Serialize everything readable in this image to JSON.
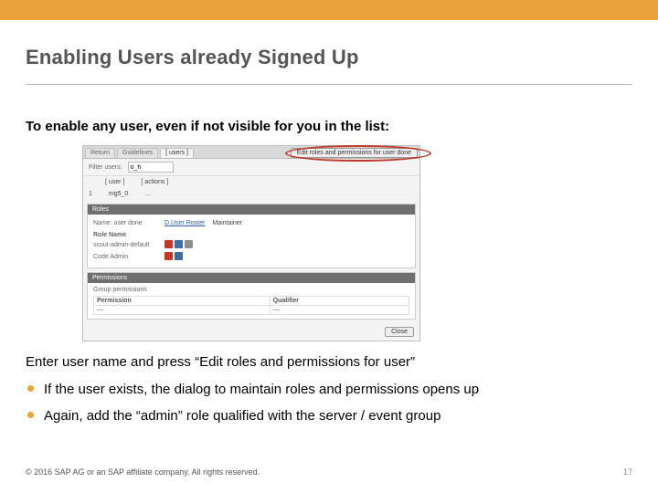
{
  "accent": "#e8a33d",
  "title": "Enabling Users already Signed Up",
  "lead": "To enable any user, even if not visible for you in the list:",
  "after_shot": "Enter user name and press “Edit roles and permissions for user”",
  "bullets": [
    "If the user exists, the dialog to maintain roles and permissions opens up",
    "Again, add the “admin” role qualified with the server / event group"
  ],
  "footer": {
    "copyright": "© 2016 SAP AG or an SAP affiliate company. All rights reserved.",
    "page": "17"
  },
  "screenshot": {
    "tabs": [
      "Return",
      "Guidelines",
      "[ users ]"
    ],
    "editbar_button": "Edit roles and permissions for user done",
    "filter_label": "Filter users:",
    "filter_value": "o_h",
    "list": {
      "columns": [
        "",
        "[ user ]",
        "[ actions ]"
      ],
      "row": {
        "idx": "1",
        "user": "mg5_0",
        "actions": "…"
      }
    },
    "panel1": {
      "title": "Roles",
      "name_label": "Name: user done",
      "name_link": "D.User Roster",
      "maintain": "Maintainer",
      "rolename_label": "Role Name",
      "rows": [
        "scout-admin-default",
        "Code Admin"
      ]
    },
    "panel2": {
      "title": "Permissions",
      "perm_head": "Group permissions",
      "columns": [
        "Permission",
        "Qualifier"
      ],
      "row": {
        "perm": "—",
        "qual": "—"
      }
    },
    "close": "Close"
  }
}
